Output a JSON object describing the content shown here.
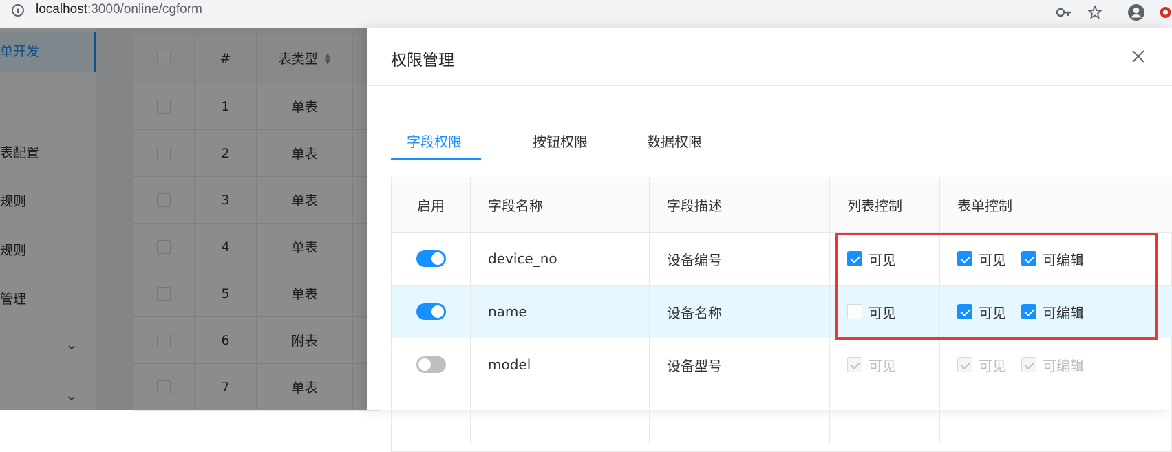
{
  "browser": {
    "url_host": "localhost",
    "url_path": ":3000/online/cgform",
    "icons": [
      "info-icon",
      "key-icon",
      "star-icon",
      "account-icon",
      "extension-icon"
    ]
  },
  "sidebar": {
    "items": [
      {
        "label": "单开发",
        "active": true
      },
      {
        "label": "表配置"
      },
      {
        "label": "规则"
      },
      {
        "label": "规则"
      },
      {
        "label": "管理"
      }
    ]
  },
  "bg_table": {
    "headers": [
      "#",
      "表类型"
    ],
    "rows": [
      {
        "num": "1",
        "type": "单表"
      },
      {
        "num": "2",
        "type": "单表"
      },
      {
        "num": "3",
        "type": "单表"
      },
      {
        "num": "4",
        "type": "单表"
      },
      {
        "num": "5",
        "type": "单表"
      },
      {
        "num": "6",
        "type": "附表"
      },
      {
        "num": "7",
        "type": "单表"
      }
    ]
  },
  "drawer": {
    "title": "权限管理",
    "tabs": [
      {
        "label": "字段权限",
        "active": true
      },
      {
        "label": "按钮权限"
      },
      {
        "label": "数据权限"
      }
    ],
    "table": {
      "headers": [
        "启用",
        "字段名称",
        "字段描述",
        "列表控制",
        "表单控制"
      ],
      "rows": [
        {
          "enabled": true,
          "field": "device_no",
          "desc": "设备编号",
          "list_visible": {
            "label": "可见",
            "checked": true
          },
          "form_visible": {
            "label": "可见",
            "checked": true
          },
          "form_edit": {
            "label": "可编辑",
            "checked": true
          }
        },
        {
          "enabled": true,
          "field": "name",
          "desc": "设备名称",
          "highlight": true,
          "list_visible": {
            "label": "可见",
            "checked": false
          },
          "form_visible": {
            "label": "可见",
            "checked": true
          },
          "form_edit": {
            "label": "可编辑",
            "checked": true
          }
        },
        {
          "enabled": false,
          "field": "model",
          "desc": "设备型号",
          "list_visible": {
            "label": "可见",
            "checked": true,
            "disabled": true
          },
          "form_visible": {
            "label": "可见",
            "checked": true,
            "disabled": true
          },
          "form_edit": {
            "label": "可编辑",
            "checked": true,
            "disabled": true
          }
        }
      ]
    }
  },
  "colors": {
    "accent": "#1890ff",
    "highlight_row": "#e6f7ff",
    "annotation": "#e53935"
  }
}
